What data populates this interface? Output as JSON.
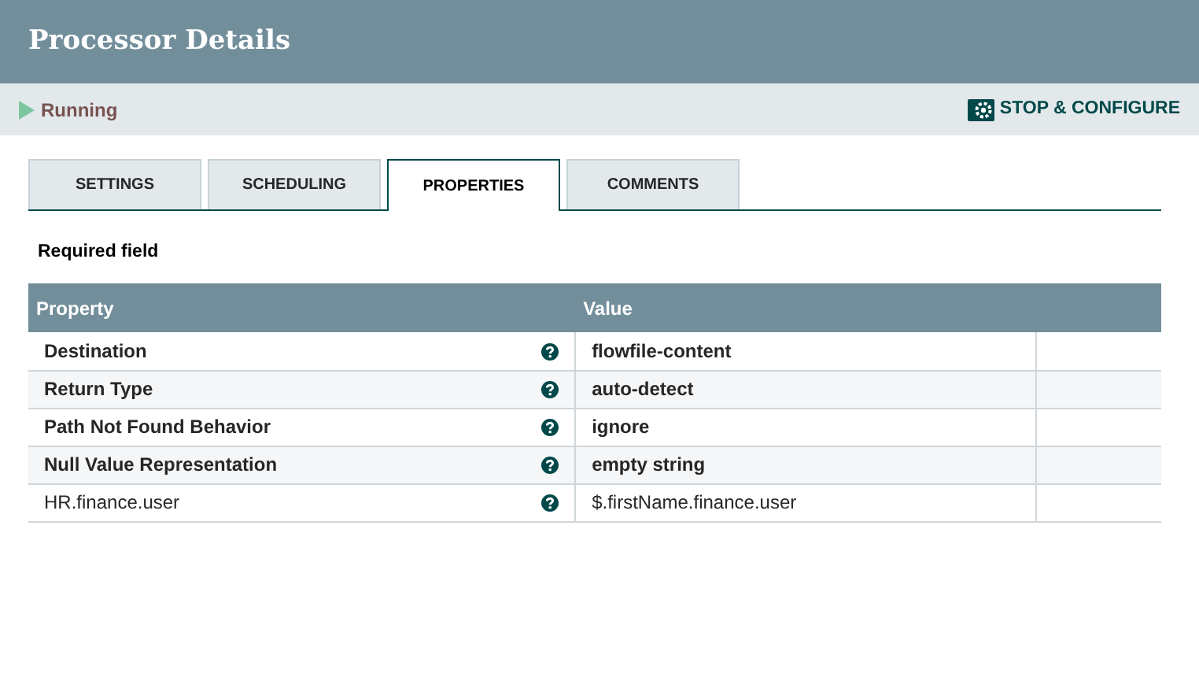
{
  "dialog": {
    "title": "Processor Details"
  },
  "status": {
    "label": "Running",
    "running": true
  },
  "action": {
    "label": "STOP & CONFIGURE"
  },
  "tabs": [
    {
      "label": "SETTINGS",
      "selected": false
    },
    {
      "label": "SCHEDULING",
      "selected": false
    },
    {
      "label": "PROPERTIES",
      "selected": true
    },
    {
      "label": "COMMENTS",
      "selected": false
    }
  ],
  "note": "Required field",
  "table": {
    "columns": [
      "Property",
      "Value"
    ],
    "rows": [
      {
        "property": "Destination",
        "value": "flowfile-content",
        "required": true
      },
      {
        "property": "Return Type",
        "value": "auto-detect",
        "required": true
      },
      {
        "property": "Path Not Found Behavior",
        "value": "ignore",
        "required": true
      },
      {
        "property": "Null Value Representation",
        "value": "empty string",
        "required": true
      },
      {
        "property": "HR.finance.user",
        "value": "$.firstName.finance.user",
        "required": false
      }
    ]
  }
}
